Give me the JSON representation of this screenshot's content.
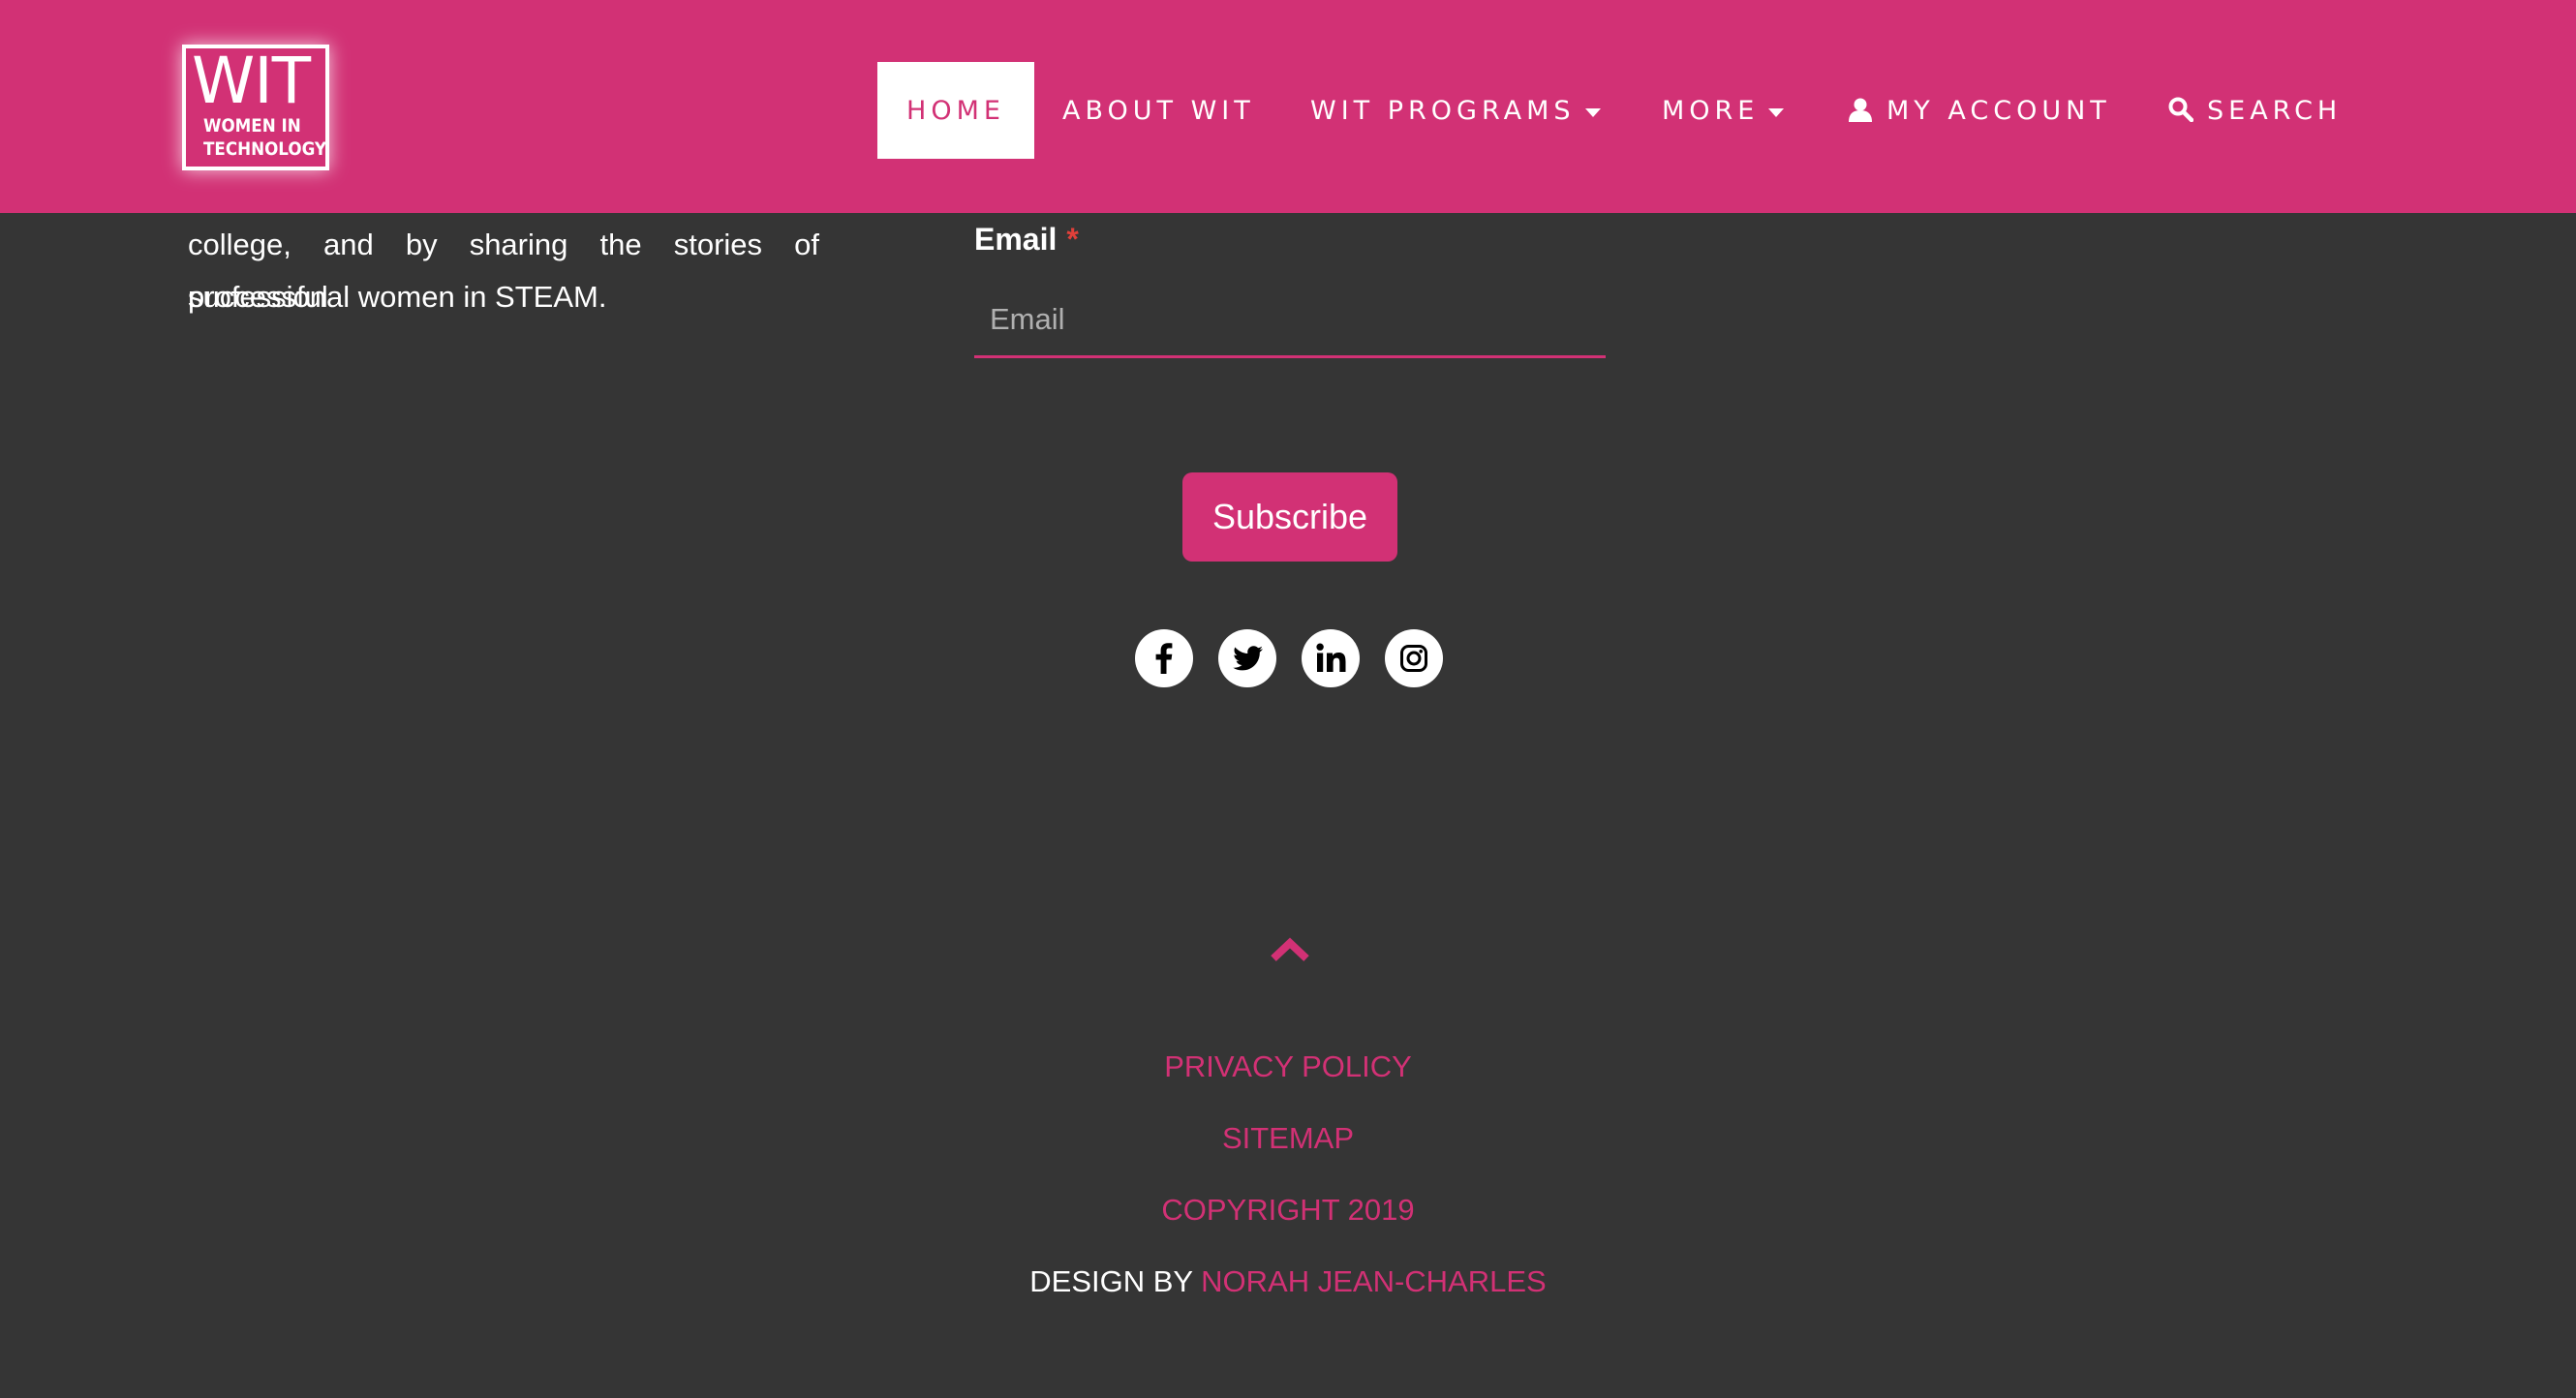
{
  "brand": {
    "logo_main": "WIT",
    "logo_sub": "WOMEN IN\nTECHNOLOGY"
  },
  "nav": {
    "home": "HOME",
    "about": "ABOUT WIT",
    "programs": "WIT PROGRAMS",
    "more": "MORE",
    "account": "MY ACCOUNT",
    "search": "SEARCH"
  },
  "about": {
    "lines": [
      "college, and by sharing the stories of successful",
      "professional women in STEAM."
    ]
  },
  "form": {
    "email_label": "Email",
    "required_mark": "*",
    "email_placeholder": "Email",
    "email_value": "",
    "subscribe_label": "Subscribe"
  },
  "social": {
    "icons": [
      "facebook-icon",
      "twitter-icon",
      "linkedin-icon",
      "instagram-icon"
    ]
  },
  "footer": {
    "privacy": "PRIVACY POLICY",
    "sitemap": "SITEMAP",
    "copyright": "COPYRIGHT 2019",
    "design_by": "DESIGN BY",
    "designer": "NORAH JEAN-CHARLES"
  },
  "colors": {
    "brand_pink": "#d23175",
    "background": "#353535",
    "required_red": "#e0403a",
    "text_white": "#ffffff"
  }
}
